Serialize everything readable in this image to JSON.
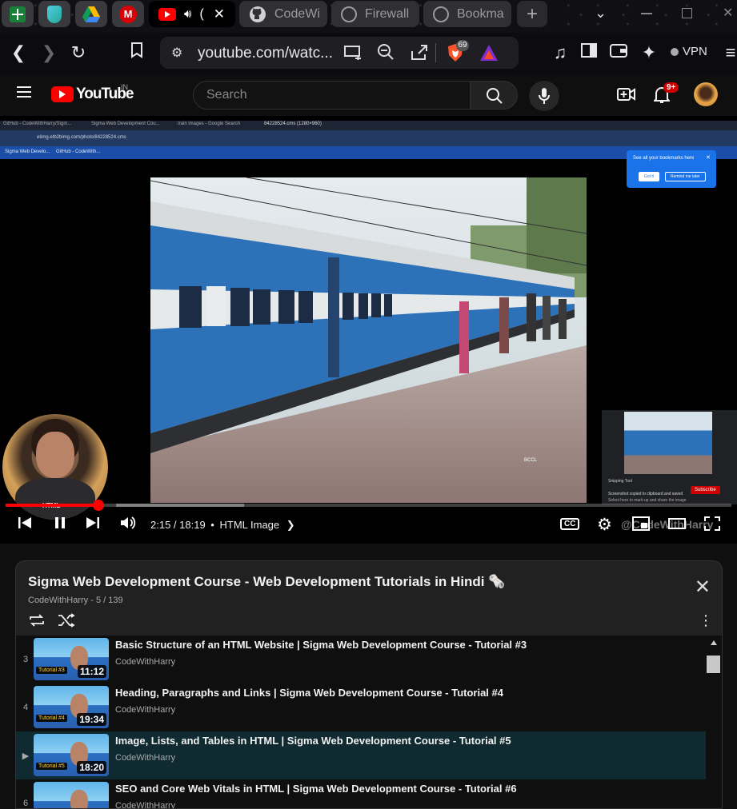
{
  "tabs": {
    "pinned": [
      {
        "icon": "sheets-icon",
        "color": "#188038"
      },
      {
        "icon": "shield-app-icon",
        "color": "#26a69a"
      },
      {
        "icon": "drive-icon",
        "color": "#fbbc04"
      },
      {
        "icon": "mega-icon",
        "color": "#d90007"
      }
    ],
    "active_label": "(",
    "items": [
      {
        "label": "CodeWi"
      },
      {
        "label": "Firewall"
      },
      {
        "label": "Bookma"
      }
    ],
    "new_tab": "+"
  },
  "nav": {
    "url": "youtube.com/watc...",
    "brave_badge": "69",
    "vpn_label": "VPN"
  },
  "youtube": {
    "logo_text": "YouTube",
    "region": "IN",
    "search_placeholder": "Search",
    "notif_count": "9+"
  },
  "video": {
    "inner_tabs": [
      "GitHub - CodeWithHarry/Sigm...",
      "Sigma Web Development Cou...",
      "train images - Google Search",
      "84228524.cms (1280×960)"
    ],
    "inner_url": "etimg.etb2bimg.com/photo/84228524.cms",
    "inner_bookmarks": [
      "Sigma Web Develo...",
      "GitHub - CodeWith..."
    ],
    "popup_text": "See all your bookmarks here",
    "popup_btn1": "Got it",
    "popup_btn2": "Remind me later",
    "photo_watermark": "BCCL",
    "pip_line1": "Snipping Tool",
    "pip_line2": "Screenshot copied to clipboard and saved",
    "pip_line3": "Select here to mark-up and share the image",
    "pip_subscribe": "Subscribe",
    "chapter_badge": "HTML",
    "progress": 0.1274,
    "time": "2:15 / 18:19",
    "chapter": "HTML Image",
    "cc": "CC",
    "channel_watermark": "@CodeWithHarry"
  },
  "playlist": {
    "title": "Sigma Web Development Course - Web Development Tutorials in Hindi 🗞️",
    "subtitle": "CodeWithHarry - 5 / 139",
    "items": [
      {
        "index": "3",
        "title": "Basic Structure of an HTML Website | Sigma Web Development Course - Tutorial #3",
        "channel": "CodeWithHarry",
        "duration": "11:12",
        "thumb_label": "Tutorial #3",
        "current": false
      },
      {
        "index": "4",
        "title": "Heading, Paragraphs and Links | Sigma Web Development Course - Tutorial #4",
        "channel": "CodeWithHarry",
        "duration": "19:34",
        "thumb_label": "Tutorial #4",
        "current": false
      },
      {
        "index": "▶",
        "title": "Image, Lists, and Tables in HTML | Sigma Web Development Course - Tutorial #5",
        "channel": "CodeWithHarry",
        "duration": "18:20",
        "thumb_label": "Tutorial #5",
        "current": true
      },
      {
        "index": "6",
        "title": "SEO and Core Web Vitals in HTML | Sigma Web Development Course - Tutorial #6",
        "channel": "CodeWithHarry",
        "duration": "",
        "thumb_label": "",
        "current": false
      }
    ]
  }
}
